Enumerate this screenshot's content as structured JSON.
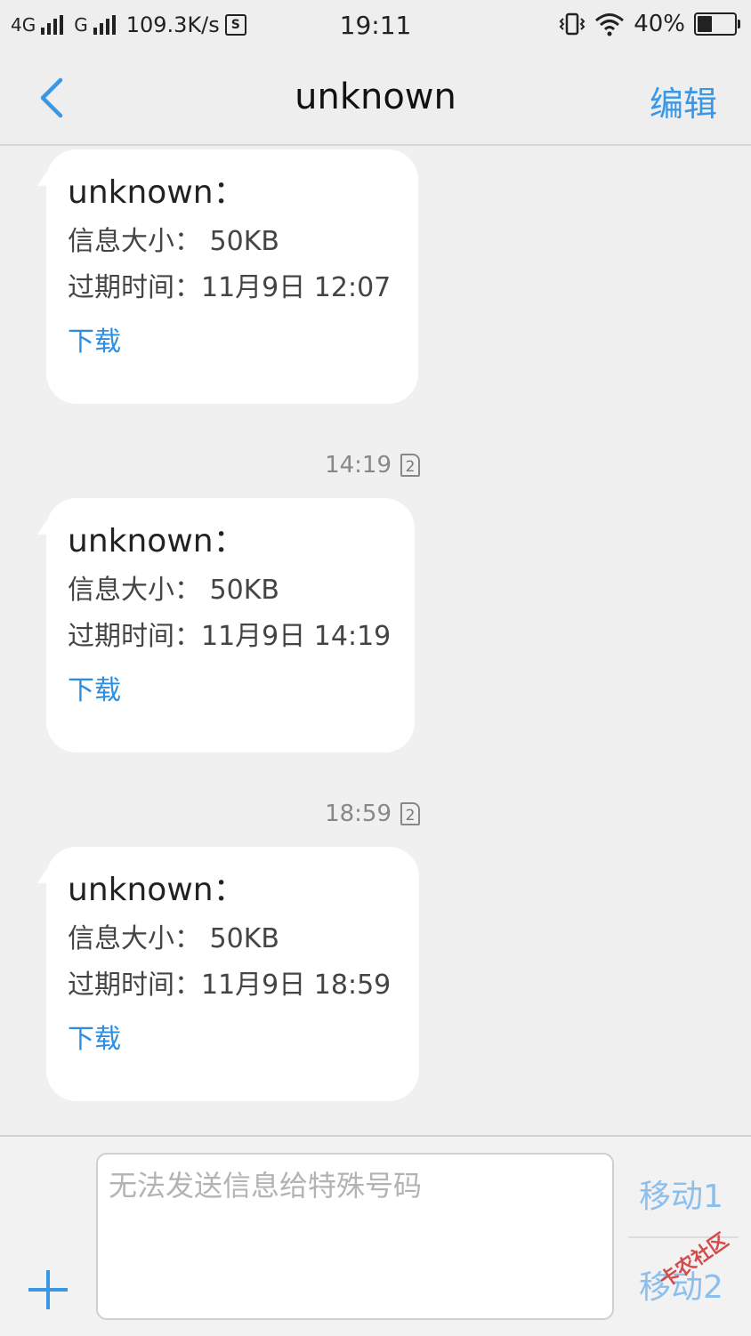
{
  "status_bar": {
    "network_1": "4G",
    "network_2": "G",
    "speed": "109.3K/s",
    "time": "19:11",
    "battery": "40%",
    "battery_level": 0.4
  },
  "header": {
    "title": "unknown",
    "edit_label": "编辑"
  },
  "messages": [
    {
      "sender": "unknown：",
      "size_text": "信息大小： 50KB",
      "expiry_text": "过期时间：11月9日 12:07",
      "download_label": "下载"
    },
    {
      "timestamp": "14:19",
      "sim": "2",
      "sender": "unknown：",
      "size_text": "信息大小： 50KB",
      "expiry_text": "过期时间：11月9日 14:19",
      "download_label": "下载"
    },
    {
      "timestamp": "18:59",
      "sim": "2",
      "sender": "unknown：",
      "size_text": "信息大小： 50KB",
      "expiry_text": "过期时间：11月9日 18:59",
      "download_label": "下载"
    }
  ],
  "composer": {
    "placeholder": "无法发送信息给特殊号码",
    "send_sim1_label": "移动1",
    "send_sim2_label": "移动2"
  },
  "watermark": "卡农社区",
  "colors": {
    "accent": "#3a97e6",
    "link": "#2d8ee0",
    "disabled_send": "#8cbfee",
    "background": "#f0f0f0",
    "bubble": "#ffffff"
  }
}
